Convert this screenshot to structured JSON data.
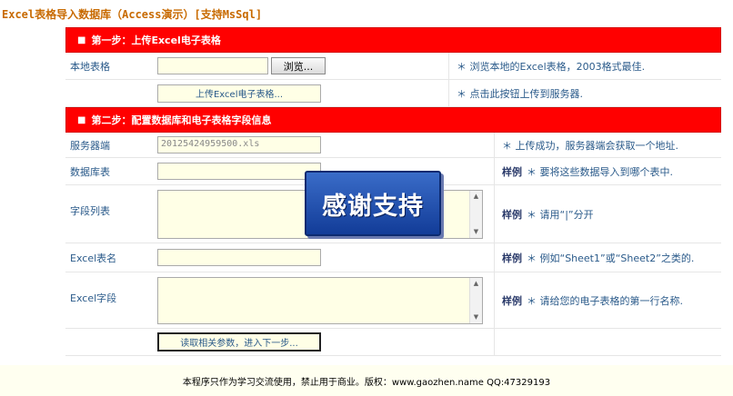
{
  "title": "Excel表格导入数据库（Access演示）[支持MsSql]",
  "step1": {
    "header": "第一步：上传Excel电子表格",
    "local_label": "本地表格",
    "file_value": "",
    "browse_label": "浏览...",
    "browse_hint": "＊ 浏览本地的Excel表格，2003格式最佳.",
    "upload_label": "上传Excel电子表格...",
    "upload_hint": "＊ 点击此按钮上传到服务器."
  },
  "step2": {
    "header": "第二步：配置数据库和电子表格字段信息",
    "server_label": "服务器端",
    "server_value": "20125424959500.xls",
    "server_hint": "＊ 上传成功，服务器端会获取一个地址.",
    "dbtable_label": "数据库表",
    "dbtable_value": "",
    "dbtable_prefix": "样例",
    "dbtable_hint": "＊ 要将这些数据导入到哪个表中.",
    "fields_label": "字段列表",
    "fields_value": "",
    "fields_prefix": "样例",
    "fields_hint": "＊ 请用“|”分开",
    "sheet_label": "Excel表名",
    "sheet_value": "",
    "sheet_prefix": "样例",
    "sheet_hint": "＊ 例如“Sheet1”或“Sheet2”之类的.",
    "excelfields_label": "Excel字段",
    "excelfields_value": "",
    "excelfields_prefix": "样例",
    "excelfields_hint": "＊ 请给您的电子表格的第一行名称.",
    "next_label": "读取相关参数，进入下一步..."
  },
  "overlay": {
    "text": "感谢支持"
  },
  "footer": {
    "text": "本程序只作为学习交流使用，禁止用于商业。版权：www.gaozhen.name QQ:47329193"
  },
  "colors": {
    "header_bg": "#ff0000",
    "title": "#c86a00",
    "input_bg": "#ffffe6",
    "badge": "#1f4fb0"
  }
}
